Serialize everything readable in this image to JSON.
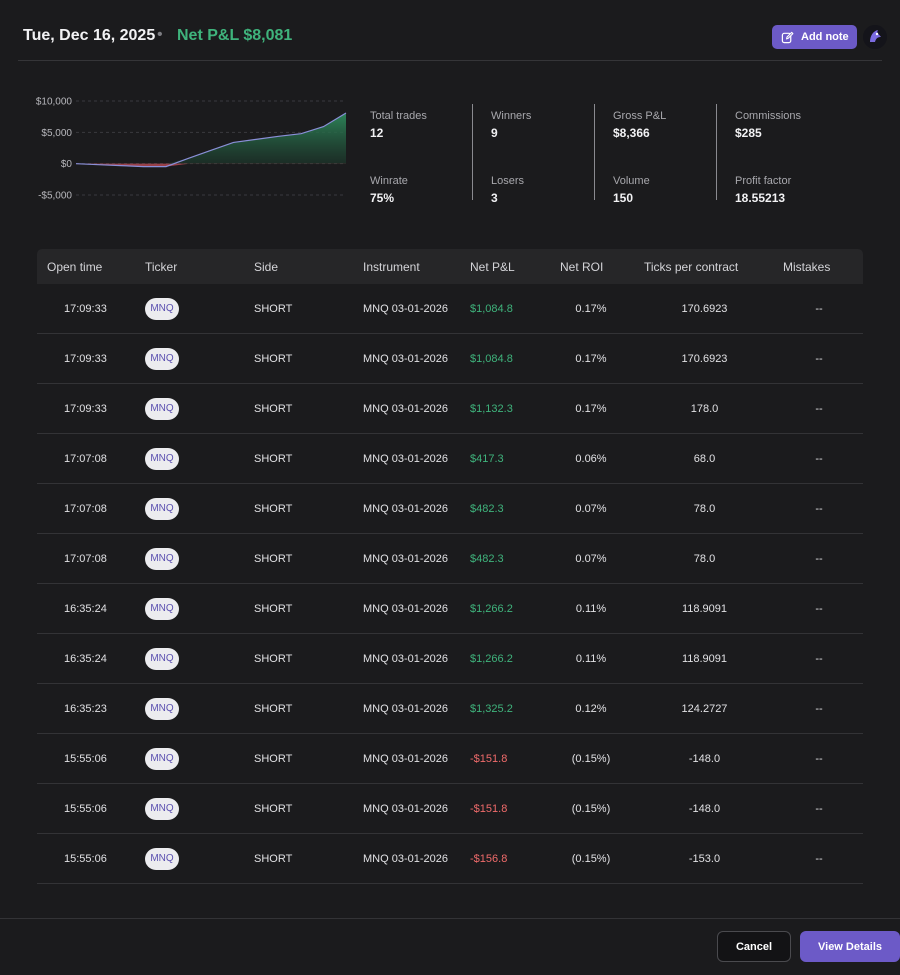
{
  "header": {
    "date": "Tue, Dec 16, 2025",
    "separator": "•",
    "net_pnl": "Net P&L $8,081",
    "add_note_label": "Add note"
  },
  "colors": {
    "accent": "#6c5ac7",
    "positive": "#3fb37c",
    "negative": "#f06b6b",
    "background": "#1b1b1d"
  },
  "chart_data": {
    "type": "area",
    "y_tick_labels": [
      "$10,000",
      "$5,000",
      "$0",
      "-$5,000"
    ],
    "ylim": [
      -5000,
      10000
    ],
    "x": [
      0,
      1,
      2,
      3,
      4,
      5,
      6,
      7,
      8,
      9,
      10,
      11,
      12
    ],
    "values": [
      0,
      -157,
      -309,
      -461,
      -461,
      864,
      2130,
      3396,
      3878,
      4360,
      4777,
      5909,
      8081
    ],
    "grid": true
  },
  "stats": [
    {
      "label": "Total trades",
      "value": "12"
    },
    {
      "label": "Winrate",
      "value": "75%"
    },
    {
      "label": "Winners",
      "value": "9"
    },
    {
      "label": "Losers",
      "value": "3"
    },
    {
      "label": "Gross P&L",
      "value": "$8,366"
    },
    {
      "label": "Volume",
      "value": "150"
    },
    {
      "label": "Commissions",
      "value": "$285"
    },
    {
      "label": "Profit factor",
      "value": "18.55213"
    }
  ],
  "table": {
    "columns": [
      "Open time",
      "Ticker",
      "Side",
      "Instrument",
      "Net P&L",
      "Net ROI",
      "Ticks per contract",
      "Mistakes"
    ],
    "rows": [
      {
        "time": "17:09:33",
        "ticker": "MNQ",
        "side": "SHORT",
        "instrument": "MNQ 03-01-2026",
        "pnl": "$1,084.8",
        "roi": "0.17%",
        "ticks": "170.6923",
        "mistakes": "--"
      },
      {
        "time": "17:09:33",
        "ticker": "MNQ",
        "side": "SHORT",
        "instrument": "MNQ 03-01-2026",
        "pnl": "$1,084.8",
        "roi": "0.17%",
        "ticks": "170.6923",
        "mistakes": "--"
      },
      {
        "time": "17:09:33",
        "ticker": "MNQ",
        "side": "SHORT",
        "instrument": "MNQ 03-01-2026",
        "pnl": "$1,132.3",
        "roi": "0.17%",
        "ticks": "178.0",
        "mistakes": "--"
      },
      {
        "time": "17:07:08",
        "ticker": "MNQ",
        "side": "SHORT",
        "instrument": "MNQ 03-01-2026",
        "pnl": "$417.3",
        "roi": "0.06%",
        "ticks": "68.0",
        "mistakes": "--"
      },
      {
        "time": "17:07:08",
        "ticker": "MNQ",
        "side": "SHORT",
        "instrument": "MNQ 03-01-2026",
        "pnl": "$482.3",
        "roi": "0.07%",
        "ticks": "78.0",
        "mistakes": "--"
      },
      {
        "time": "17:07:08",
        "ticker": "MNQ",
        "side": "SHORT",
        "instrument": "MNQ 03-01-2026",
        "pnl": "$482.3",
        "roi": "0.07%",
        "ticks": "78.0",
        "mistakes": "--"
      },
      {
        "time": "16:35:24",
        "ticker": "MNQ",
        "side": "SHORT",
        "instrument": "MNQ 03-01-2026",
        "pnl": "$1,266.2",
        "roi": "0.11%",
        "ticks": "118.9091",
        "mistakes": "--"
      },
      {
        "time": "16:35:24",
        "ticker": "MNQ",
        "side": "SHORT",
        "instrument": "MNQ 03-01-2026",
        "pnl": "$1,266.2",
        "roi": "0.11%",
        "ticks": "118.9091",
        "mistakes": "--"
      },
      {
        "time": "16:35:23",
        "ticker": "MNQ",
        "side": "SHORT",
        "instrument": "MNQ 03-01-2026",
        "pnl": "$1,325.2",
        "roi": "0.12%",
        "ticks": "124.2727",
        "mistakes": "--"
      },
      {
        "time": "15:55:06",
        "ticker": "MNQ",
        "side": "SHORT",
        "instrument": "MNQ 03-01-2026",
        "pnl": "-$151.8",
        "roi": "(0.15%)",
        "ticks": "-148.0",
        "mistakes": "--"
      },
      {
        "time": "15:55:06",
        "ticker": "MNQ",
        "side": "SHORT",
        "instrument": "MNQ 03-01-2026",
        "pnl": "-$151.8",
        "roi": "(0.15%)",
        "ticks": "-148.0",
        "mistakes": "--"
      },
      {
        "time": "15:55:06",
        "ticker": "MNQ",
        "side": "SHORT",
        "instrument": "MNQ 03-01-2026",
        "pnl": "-$156.8",
        "roi": "(0.15%)",
        "ticks": "-153.0",
        "mistakes": "--"
      }
    ]
  },
  "footer": {
    "cancel_label": "Cancel",
    "view_details_label": "View Details"
  }
}
